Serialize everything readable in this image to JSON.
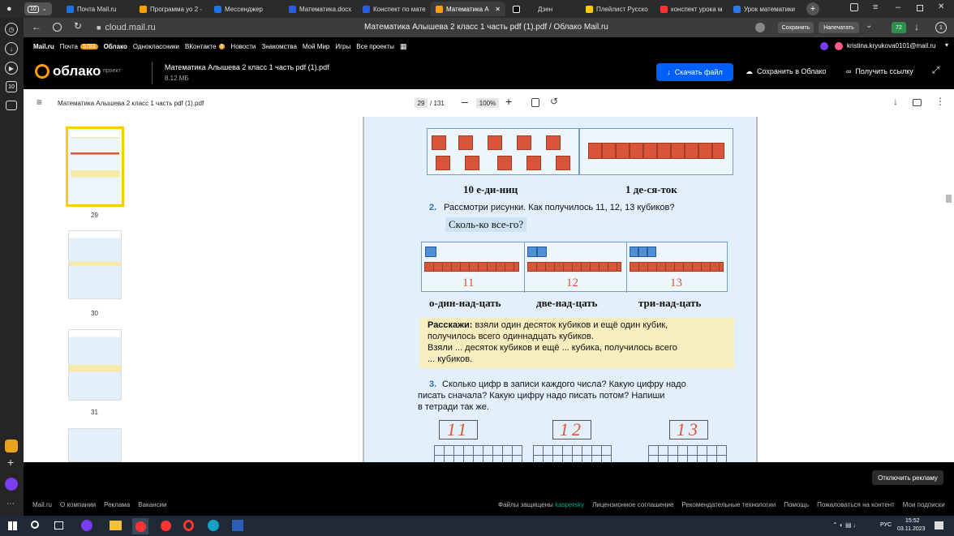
{
  "browser": {
    "tab_count": "10",
    "tabs": [
      {
        "label": "Почта Mail.ru",
        "color": "#1a73e8"
      },
      {
        "label": "Программа уо 2 -",
        "color": "#ff9e00"
      },
      {
        "label": "Мессенджер",
        "color": "#1a73e8"
      },
      {
        "label": "Математика.docx",
        "color": "#2a5ee8"
      },
      {
        "label": "Конспект по мате",
        "color": "#2a5ee8"
      },
      {
        "label": "Математика А",
        "color": "#ff9e00"
      },
      {
        "label": "Дзен",
        "color": "#000000"
      },
      {
        "label": "Плейлист Русско",
        "color": "#ffcc00"
      },
      {
        "label": "конспект урока м",
        "color": "#f33"
      },
      {
        "label": "Урок математики",
        "color": "#2a7ae8"
      }
    ],
    "address": "cloud.mail.ru",
    "page_title": "Математика Алышева 2 класс 1 часть pdf (1).pdf / Облако Mail.ru",
    "save_btn": "Сохранить",
    "print_btn": "Напечатать",
    "badge_count": "72",
    "notif_count": "1",
    "sidebar_badge": "10"
  },
  "mailnav": {
    "items": [
      "Mail.ru",
      "Почта",
      "Облако",
      "Одноклассники",
      "ВКонтакте",
      "Новости",
      "Знакомства",
      "Мой Мир",
      "Игры",
      "Все проекты"
    ],
    "mail_badge": "5783",
    "vk_badge": "8",
    "user": "kristina.kryukova0101@mail.ru"
  },
  "cloud": {
    "logo": "облако",
    "project": "проект",
    "file_name": "Математика Алышева 2 класс 1 часть pdf (1).pdf",
    "file_size": "8.12 МБ",
    "download": "Скачать файл",
    "save_cloud": "Сохранить в Облако",
    "get_link": "Получить ссылку"
  },
  "pdf": {
    "title": "Математика Алышева 2 класс 1 часть pdf (1).pdf",
    "page": "29",
    "total": "/ 131",
    "zoom": "100%",
    "thumbs": [
      "29",
      "30",
      "31"
    ]
  },
  "content": {
    "ten_units": "10 е-ди-ниц",
    "one_ten": "1 де-ся-ток",
    "task2_num": "2.",
    "task2": "Рассмотри рисунки. Как получилось 11, 12, 13 кубиков?",
    "task2_q": "Сколь-ко все-го?",
    "n11": "11",
    "n12": "12",
    "n13": "13",
    "w11": "о-дин-над-цать",
    "w12": "две-над-цать",
    "w13": "три-над-цать",
    "tell_bold": "Расскажи:",
    "tell1": " взяли один десяток кубиков и ещё один кубик,",
    "tell2": "получилось всего одиннадцать кубиков.",
    "tell3": "Взяли ... десяток кубиков и ещё ... кубика, получилось всего",
    "tell4": "... кубиков.",
    "task3_num": "3.",
    "task3a": "Сколько цифр в записи каждого числа? Какую цифру надо",
    "task3b": "писать сначала? Какую цифру надо писать потом? Напиши",
    "task3c": "в тетради так же.",
    "hw11": "11",
    "hw12": "12",
    "hw13": "13"
  },
  "footer": {
    "disable_ads": "Отключить рекламу",
    "links_left": [
      "Mail.ru",
      "О компании",
      "Реклама",
      "Вакансии"
    ],
    "protected": "Файлы защищены",
    "kaspersky": "kaspersky",
    "links_right": [
      "Лицензионное соглашение",
      "Рекомендательные технологии",
      "Помощь",
      "Пожаловаться на контент",
      "Мои подписки"
    ]
  },
  "taskbar": {
    "lang": "РУС",
    "time": "15:52",
    "date": "03.11.2023"
  }
}
